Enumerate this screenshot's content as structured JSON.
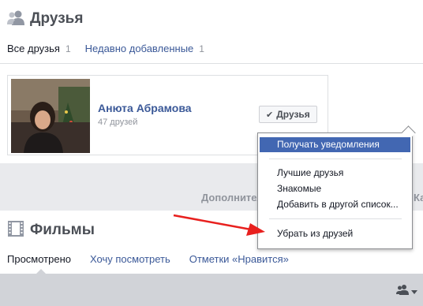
{
  "friends": {
    "title": "Друзья",
    "tabs": [
      {
        "label": "Все друзья",
        "count": "1"
      },
      {
        "label": "Недавно добавленные",
        "count": "1"
      }
    ],
    "friend": {
      "name": "Анюта Абрамова",
      "meta": "47 друзей",
      "button_label": "Друзья"
    },
    "more_label": "Дополнительно",
    "more_right": "Ка"
  },
  "dropdown": {
    "items": [
      "Получать уведомления",
      "Лучшие друзья",
      "Знакомые",
      "Добавить в другой список...",
      "Убрать из друзей"
    ]
  },
  "movies": {
    "title": "Фильмы",
    "tabs": [
      "Просмотрено",
      "Хочу посмотреть",
      "Отметки «Нравится»"
    ]
  },
  "colors": {
    "link": "#3b5998",
    "highlight": "#4267b2",
    "arrow": "#e8201e"
  }
}
